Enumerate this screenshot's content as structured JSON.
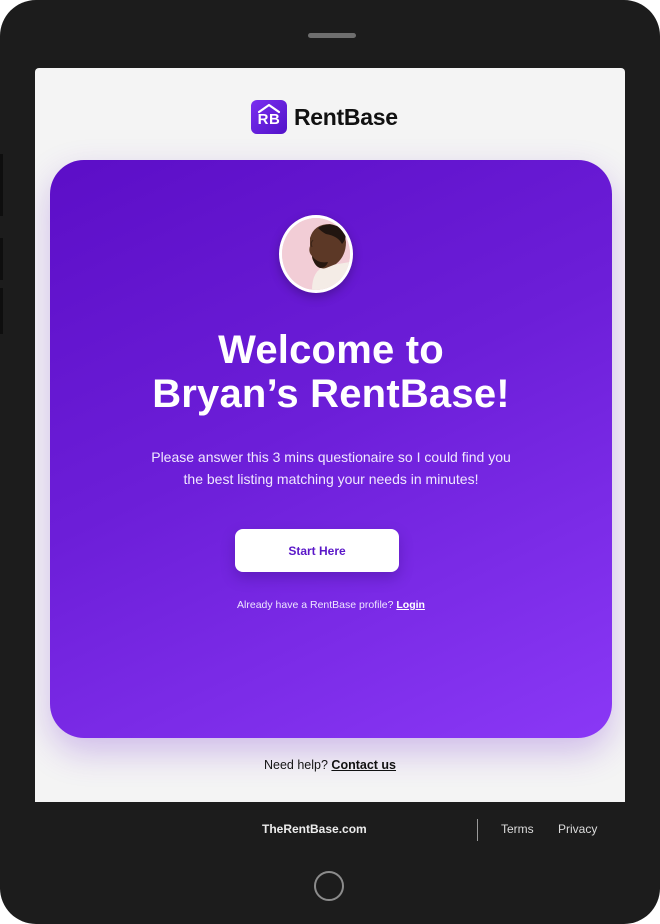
{
  "brand": {
    "logo_letters": "RB",
    "name": "RentBase",
    "accent_color": "#6a1bd6"
  },
  "welcome": {
    "headline_line1": "Welcome to",
    "headline_line2": "Bryan’s RentBase!",
    "subtext_line1": "Please answer this 3 mins questionaire so I could find you",
    "subtext_line2": "the best listing matching your needs in minutes!",
    "start_button": "Start Here",
    "login_prompt": "Already have a RentBase profile?",
    "login_link": "Login"
  },
  "help": {
    "prompt": "Need help?",
    "link": "Contact us"
  },
  "footer": {
    "site": "TheRentBase.com",
    "terms": "Terms",
    "privacy": "Privacy"
  },
  "icons": {
    "logo": "house-roof-icon",
    "home_button": "home-button-icon",
    "avatar": "user-avatar-photo"
  }
}
